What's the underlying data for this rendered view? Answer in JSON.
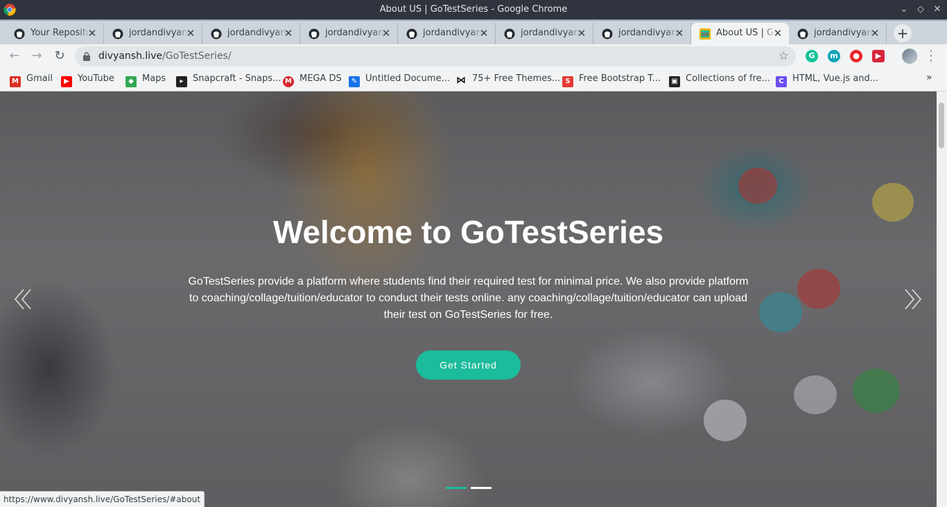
{
  "window": {
    "title": "About US | GoTestSeries - Google Chrome"
  },
  "tabs": [
    {
      "label": "Your Repositories",
      "icon": "github-icon",
      "active": false
    },
    {
      "label": "jordandivyansh",
      "icon": "github-icon",
      "active": false
    },
    {
      "label": "jordandivyansh",
      "icon": "github-icon",
      "active": false
    },
    {
      "label": "jordandivyansh",
      "icon": "github-icon",
      "active": false
    },
    {
      "label": "jordandivyansh",
      "icon": "github-icon",
      "active": false
    },
    {
      "label": "jordandivyansh",
      "icon": "github-icon",
      "active": false
    },
    {
      "label": "jordandivyansh",
      "icon": "github-icon",
      "active": false
    },
    {
      "label": "About US | GoTestSeries",
      "icon": "gotestseries-icon",
      "active": true
    },
    {
      "label": "jordandivyansh",
      "icon": "github-icon",
      "active": false
    }
  ],
  "toolbar": {
    "url_host": "divyansh.live",
    "url_path": "/GoTestSeries/"
  },
  "bookmarks": [
    {
      "label": "Gmail",
      "icon": "gmail-icon",
      "color": "#d93025",
      "glyph": "M"
    },
    {
      "label": "YouTube",
      "icon": "youtube-icon",
      "color": "#ff0000",
      "glyph": "▶"
    },
    {
      "label": "Maps",
      "icon": "maps-icon",
      "color": "#34a853",
      "glyph": "◆"
    },
    {
      "label": "Snapcraft - Snaps...",
      "icon": "snapcraft-icon",
      "color": "#222222",
      "glyph": "▸"
    },
    {
      "label": "MEGA DS",
      "icon": "mega-icon",
      "color": "#d9272e",
      "glyph": "M"
    },
    {
      "label": "Untitled Docume...",
      "icon": "document-icon",
      "color": "#1a73e8",
      "glyph": "✎"
    },
    {
      "label": "75+ Free Themes...",
      "icon": "bowtie-icon",
      "color": "#111111",
      "glyph": "⋈"
    },
    {
      "label": "Free Bootstrap T...",
      "icon": "bootstrap-icon",
      "color": "#e53935",
      "glyph": "S"
    },
    {
      "label": "Collections of fre...",
      "icon": "collections-icon",
      "color": "#222222",
      "glyph": "▣"
    },
    {
      "label": "HTML, Vue.js and...",
      "icon": "vue-icon",
      "color": "#6c4ef2",
      "glyph": "C"
    }
  ],
  "hero": {
    "title": "Welcome to GoTestSeries",
    "text": "GoTestSeries provide a platform where students find their required test for minimal price. We also provide platform to coaching/collage/tuition/educator to conduct their tests online. any coaching/collage/tuition/educator can upload their test on GoTestSeries for free.",
    "cta_label": "Get Started",
    "accent_color": "#1bbc9b"
  },
  "status": {
    "url": "https://www.divyansh.live/GoTestSeries/#about"
  }
}
